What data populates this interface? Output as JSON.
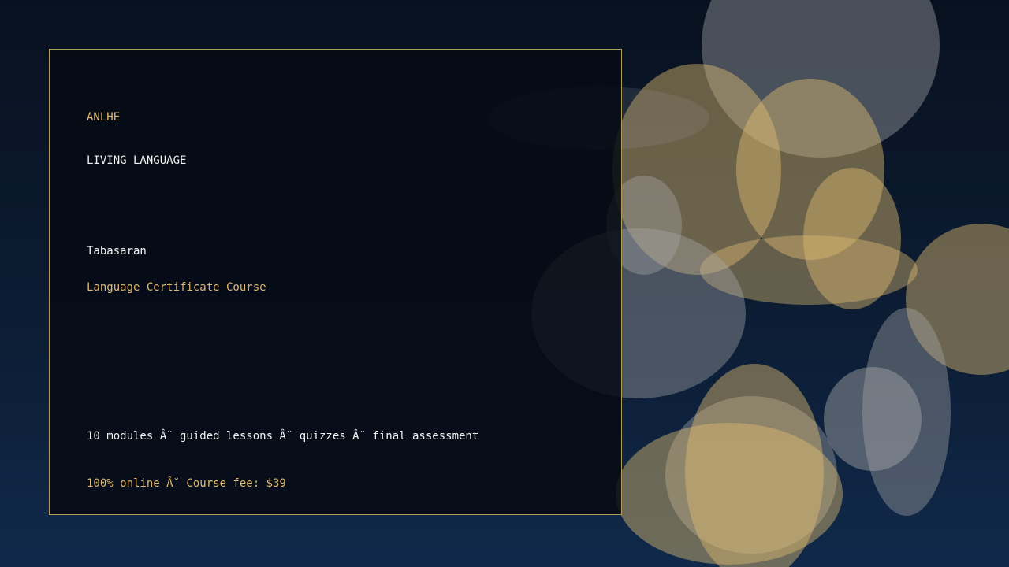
{
  "brand": "ANLHE",
  "tagline": "LIVING LANGUAGE",
  "language": "Tabasaran",
  "course_title": "Language Certificate Course",
  "details": "10 modules Â˘ guided lessons Â˘ quizzes Â˘ final assessment",
  "fee_line": "100% online Â˘ Course fee: $39",
  "colors": {
    "accent": "#e1b870",
    "text": "#f2f2f2",
    "panel_border": "#b39a5c",
    "background_top": "#08111f",
    "background_bottom": "#10294a"
  }
}
